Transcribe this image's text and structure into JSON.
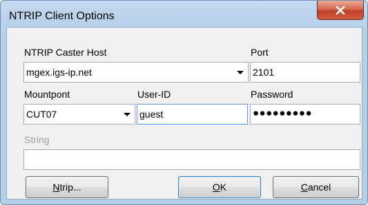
{
  "window": {
    "title": "NTRIP Client Options",
    "close_icon": "close-icon"
  },
  "caster_host": {
    "label": "NTRIP Caster Host",
    "value": "mgex.igs-ip.net"
  },
  "port": {
    "label": "Port",
    "value": "2101"
  },
  "mountpoint": {
    "label": "Mountpont",
    "value": "CUT07"
  },
  "user_id": {
    "label": "User-ID",
    "value": "guest"
  },
  "password": {
    "label": "Password",
    "value": "●●●●●●●●●"
  },
  "string": {
    "label": "String",
    "value": ""
  },
  "buttons": {
    "ntrip_prefix": "N",
    "ntrip_rest": "trip...",
    "ok_prefix": "O",
    "ok_rest": "K",
    "cancel_prefix": "C",
    "cancel_rest": "ancel"
  }
}
